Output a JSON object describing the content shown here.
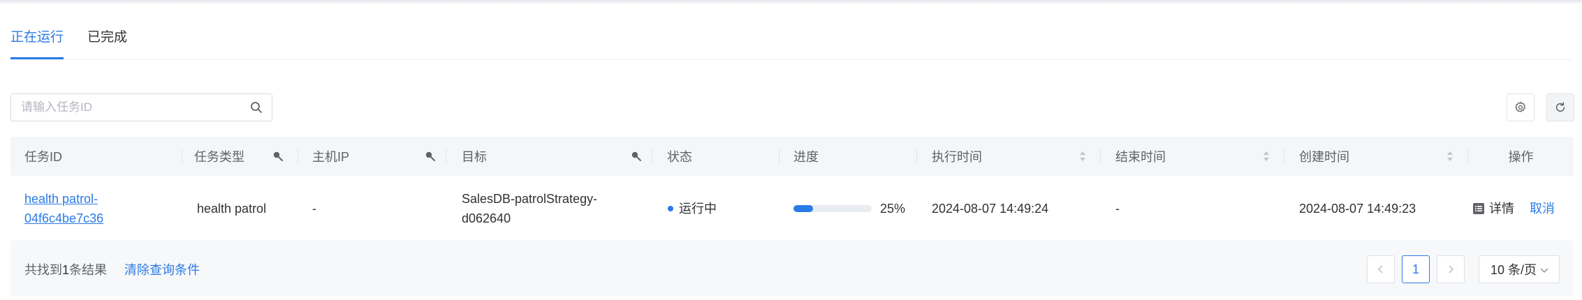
{
  "tabs": [
    {
      "label": "正在运行",
      "active": true
    },
    {
      "label": "已完成",
      "active": false
    }
  ],
  "search": {
    "placeholder": "请输入任务ID",
    "value": ""
  },
  "toolbar": {
    "settings_icon": "gear-icon",
    "refresh_icon": "refresh-icon"
  },
  "table": {
    "columns": [
      "任务ID",
      "任务类型",
      "主机IP",
      "目标",
      "状态",
      "进度",
      "执行时间",
      "结束时间",
      "创建时间",
      "操作"
    ],
    "rows": [
      {
        "task_id_line1": "health patrol-",
        "task_id_line2": "04f6c4be7c36",
        "task_type": "health patrol",
        "host_ip": "-",
        "target_line1": "SalesDB-patrolStrategy-",
        "target_line2": "d062640",
        "status": "运行中",
        "progress": 25,
        "progress_label": "25%",
        "exec_time": "2024-08-07 14:49:24",
        "end_time": "-",
        "created_time": "2024-08-07 14:49:23",
        "op_detail": "详情",
        "op_cancel": "取消"
      }
    ]
  },
  "footer": {
    "total_prefix": "共找到",
    "total_count": "1",
    "total_suffix": "条结果",
    "clear_label": "清除查询条件",
    "current_page": "1",
    "page_size_label": "10 条/页"
  },
  "colors": {
    "accent": "#2a7be6",
    "header_bg": "#f5f6f8",
    "footer_bg": "#f7f8fa"
  }
}
